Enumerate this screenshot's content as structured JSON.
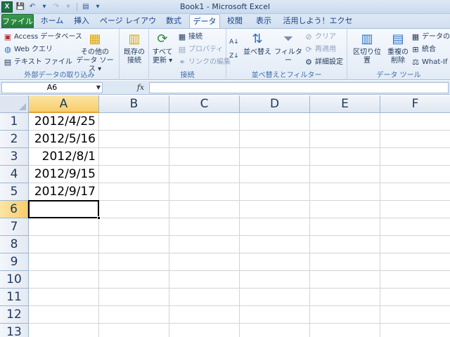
{
  "window": {
    "title": "Book1 - Microsoft Excel",
    "app_icon": "X"
  },
  "tabs": [
    {
      "label": "ファイル"
    },
    {
      "label": "ホーム"
    },
    {
      "label": "挿入"
    },
    {
      "label": "ページ レイアウト"
    },
    {
      "label": "数式"
    },
    {
      "label": "データ"
    },
    {
      "label": "校閲"
    },
    {
      "label": "表示"
    },
    {
      "label": "活用しよう！エクセル"
    }
  ],
  "ribbon": {
    "external": {
      "access": "Access データベース",
      "web": "Web クエリ",
      "text": "テキスト ファイル",
      "other_line1": "その他の",
      "other_line2": "データ ソース ▾",
      "existing_line1": "既存の",
      "existing_line2": "接続",
      "label": "外部データの取り込み"
    },
    "connections": {
      "refresh_line1": "すべて",
      "refresh_line2": "更新 ▾",
      "connect": "接続",
      "properties": "プロパティ",
      "edit_links": "リンクの編集",
      "label": "接続"
    },
    "sort": {
      "sort": "並べ替え",
      "filter": "フィルター",
      "clear": "クリア",
      "reapply": "再適用",
      "advanced": "詳細設定",
      "label": "並べ替えとフィルター"
    },
    "tools": {
      "text_to_columns": "区切り位置",
      "remove_dup_line1": "重複の",
      "remove_dup_line2": "削除",
      "validation": "データの入",
      "consolidate": "統合",
      "whatif": "What-If",
      "label": "データ ツール"
    }
  },
  "formula_bar": {
    "name_box": "A6",
    "fx": "fx",
    "value": ""
  },
  "grid": {
    "columns": [
      "A",
      "B",
      "C",
      "D",
      "E",
      "F"
    ],
    "rows": [
      "1",
      "2",
      "3",
      "4",
      "5",
      "6",
      "7",
      "8",
      "9",
      "10",
      "11",
      "12",
      "13"
    ],
    "cells_a": [
      "2012/4/25",
      "2012/5/16",
      "2012/8/1",
      "2012/9/15",
      "2012/9/17"
    ],
    "active_cell": "A6"
  },
  "colors": {
    "file_tab": "#22793a",
    "selected_header": "#f8cd6b",
    "ribbon_bg": "#e2ebf6"
  }
}
